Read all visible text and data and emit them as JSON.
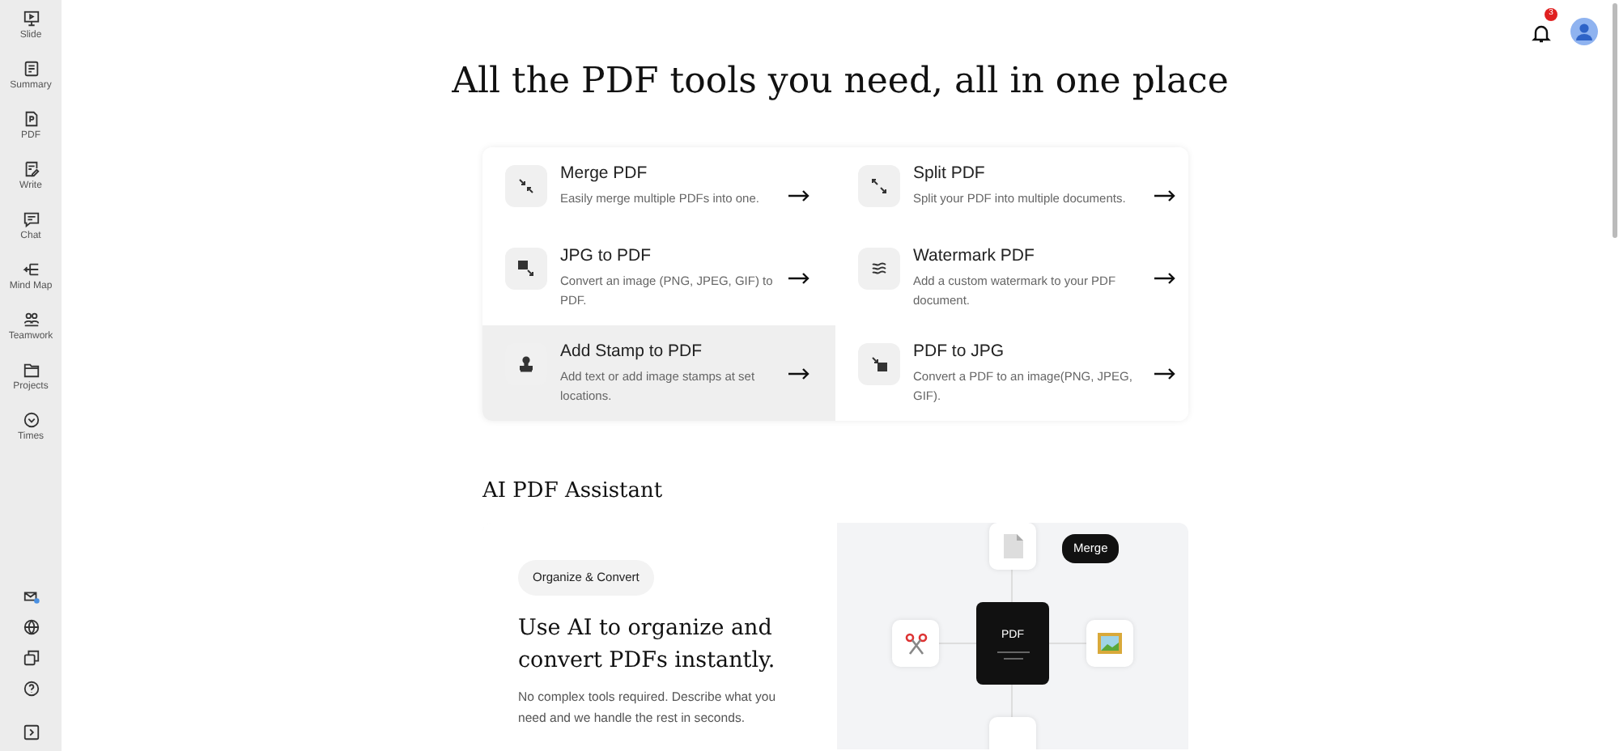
{
  "sidebar": {
    "items": [
      {
        "label": "Slide"
      },
      {
        "label": "Summary"
      },
      {
        "label": "PDF"
      },
      {
        "label": "Write"
      },
      {
        "label": "Chat"
      },
      {
        "label": "Mind Map"
      },
      {
        "label": "Teamwork"
      },
      {
        "label": "Projects"
      },
      {
        "label": "Times"
      }
    ]
  },
  "header": {
    "notification_count": "3"
  },
  "title": "All the PDF tools you need, all in one place",
  "tools": [
    {
      "title": "Merge PDF",
      "description": "Easily merge multiple PDFs into one.",
      "highlighted": false
    },
    {
      "title": "Split PDF",
      "description": "Split your PDF into multiple documents.",
      "highlighted": false
    },
    {
      "title": "JPG to PDF",
      "description": "Convert an image (PNG, JPEG, GIF) to PDF.",
      "highlighted": false
    },
    {
      "title": "Watermark PDF",
      "description": "Add a custom watermark to your PDF document.",
      "highlighted": false
    },
    {
      "title": "Add Stamp to PDF",
      "description": "Add text or add image stamps at set locations.",
      "highlighted": true
    },
    {
      "title": "PDF to JPG",
      "description": "Convert a PDF to an image(PNG, JPEG, GIF).",
      "highlighted": false
    }
  ],
  "assistant": {
    "heading": "AI PDF Assistant",
    "tag": "Organize & Convert",
    "title": "Use AI to organize and convert PDFs instantly.",
    "description": "No complex tools required. Describe what you need and we handle the rest in seconds.",
    "diagram": {
      "center_label": "PDF",
      "badge": "Merge"
    }
  }
}
